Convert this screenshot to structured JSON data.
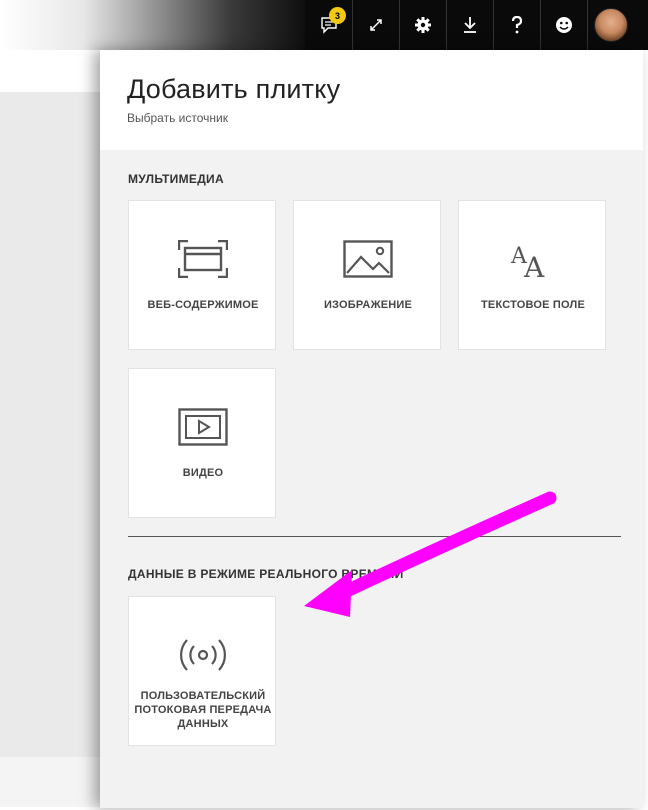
{
  "toolbar": {
    "notification_count": "3",
    "icons": [
      "comments-icon",
      "expand-icon",
      "gear-icon",
      "download-icon",
      "help-icon",
      "feedback-smiley-icon",
      "avatar"
    ]
  },
  "pane": {
    "title": "Добавить плитку",
    "subtitle": "Выбрать источник"
  },
  "multimedia": {
    "section_title": "МУЛЬТИМЕДИА",
    "tiles": [
      {
        "label": "ВЕБ-СОДЕРЖИМОЕ",
        "icon": "web-content-icon"
      },
      {
        "label": "ИЗОБРАЖЕНИЕ",
        "icon": "image-icon"
      },
      {
        "label": "ТЕКСТОВОЕ ПОЛЕ",
        "icon": "text-box-icon"
      },
      {
        "label": "ВИДЕО",
        "icon": "video-icon"
      }
    ]
  },
  "realtime": {
    "section_title": "ДАННЫЕ В РЕЖИМЕ РЕАЛЬНОГО ВРЕМЕНИ",
    "tiles": [
      {
        "label_line1": "ПОЛЬЗОВАТЕЛЬСКИЙ",
        "label_line2": "ПОТОКОВАЯ ПЕРЕДАЧА",
        "label_line3": "ДАННЫХ",
        "icon": "streaming-icon"
      }
    ]
  },
  "colors": {
    "toolbar_bg": "#0a0a0a",
    "badge": "#f2c811",
    "pane_bg": "#f2f2f2",
    "arrow": "#ff00ff"
  }
}
